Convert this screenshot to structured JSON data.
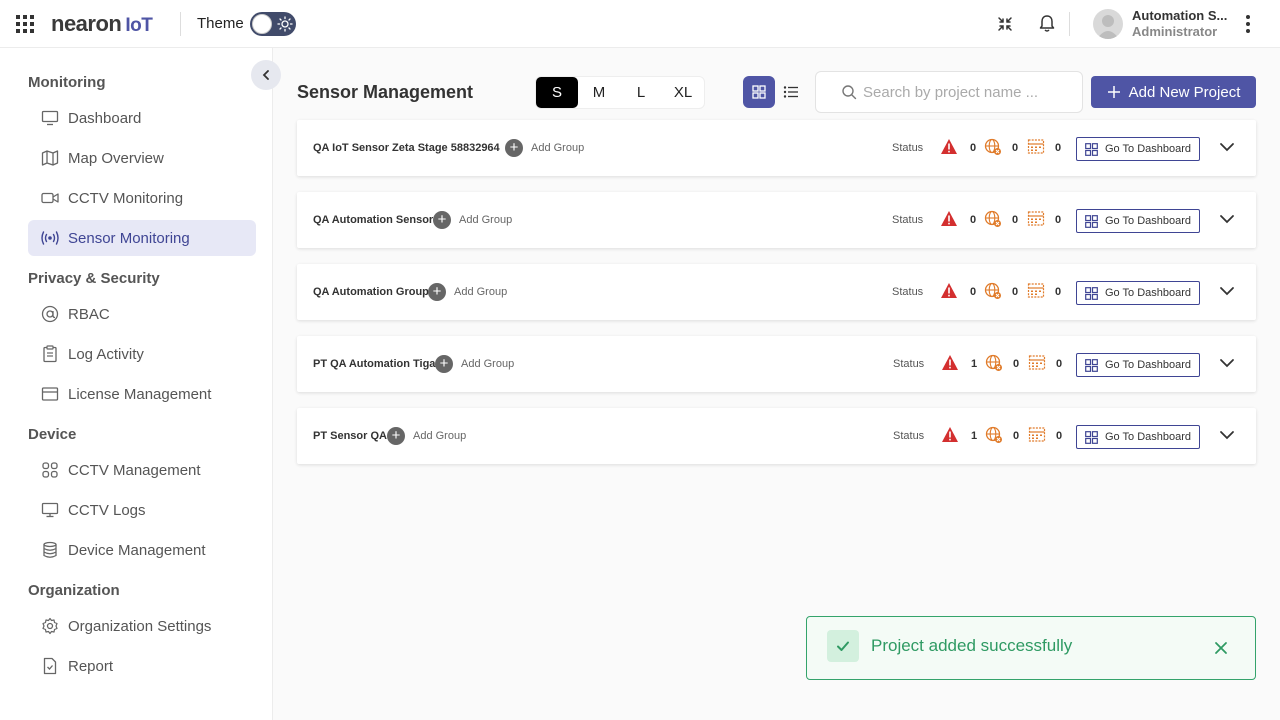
{
  "app": {
    "logo_main": "nearon",
    "logo_suffix": "IoT",
    "theme_label": "Theme"
  },
  "user": {
    "name": "Automation S...",
    "role": "Administrator"
  },
  "sidebar": {
    "sections": [
      {
        "title": "Monitoring",
        "items": [
          {
            "label": "Dashboard",
            "icon": "monitor-icon"
          },
          {
            "label": "Map Overview",
            "icon": "map-icon"
          },
          {
            "label": "CCTV Monitoring",
            "icon": "video-camera-icon"
          },
          {
            "label": "Sensor Monitoring",
            "icon": "broadcast-icon",
            "active": true
          }
        ]
      },
      {
        "title": "Privacy & Security",
        "items": [
          {
            "label": "RBAC",
            "icon": "at-sign-icon"
          },
          {
            "label": "Log Activity",
            "icon": "clipboard-icon"
          },
          {
            "label": "License Management",
            "icon": "id-card-icon"
          }
        ]
      },
      {
        "title": "Device",
        "items": [
          {
            "label": "CCTV Management",
            "icon": "grid-apps-icon"
          },
          {
            "label": "CCTV Logs",
            "icon": "desktop-icon"
          },
          {
            "label": "Device Management",
            "icon": "database-icon"
          }
        ]
      },
      {
        "title": "Organization",
        "items": [
          {
            "label": "Organization Settings",
            "icon": "gear-icon"
          },
          {
            "label": "Report",
            "icon": "file-check-icon"
          }
        ]
      }
    ]
  },
  "main": {
    "title": "Sensor Management",
    "sizes": [
      "S",
      "M",
      "L",
      "XL"
    ],
    "selected_size": "S",
    "view_mode": "grid",
    "search": {
      "placeholder": "Search by project name ...",
      "value": ""
    },
    "add_button": "Add New Project",
    "add_group_label": "Add Group",
    "status_label": "Status",
    "goto_label": "Go To Dashboard",
    "projects": [
      {
        "name": "QA IoT Sensor Zeta Stage 58832964",
        "alerts": "0",
        "network": "0",
        "calendar": "0"
      },
      {
        "name": "QA Automation Sensor",
        "alerts": "0",
        "network": "0",
        "calendar": "0"
      },
      {
        "name": "QA Automation Group",
        "alerts": "0",
        "network": "0",
        "calendar": "0"
      },
      {
        "name": "PT QA Automation Tiga",
        "alerts": "1",
        "network": "0",
        "calendar": "0"
      },
      {
        "name": "PT Sensor QA",
        "alerts": "1",
        "network": "0",
        "calendar": "0"
      }
    ]
  },
  "toast": {
    "message": "Project added successfully",
    "color": "#2f9a63"
  },
  "colors": {
    "accent": "#4f55a5",
    "alert": "#d32f2f",
    "network": "#e07b2a"
  }
}
